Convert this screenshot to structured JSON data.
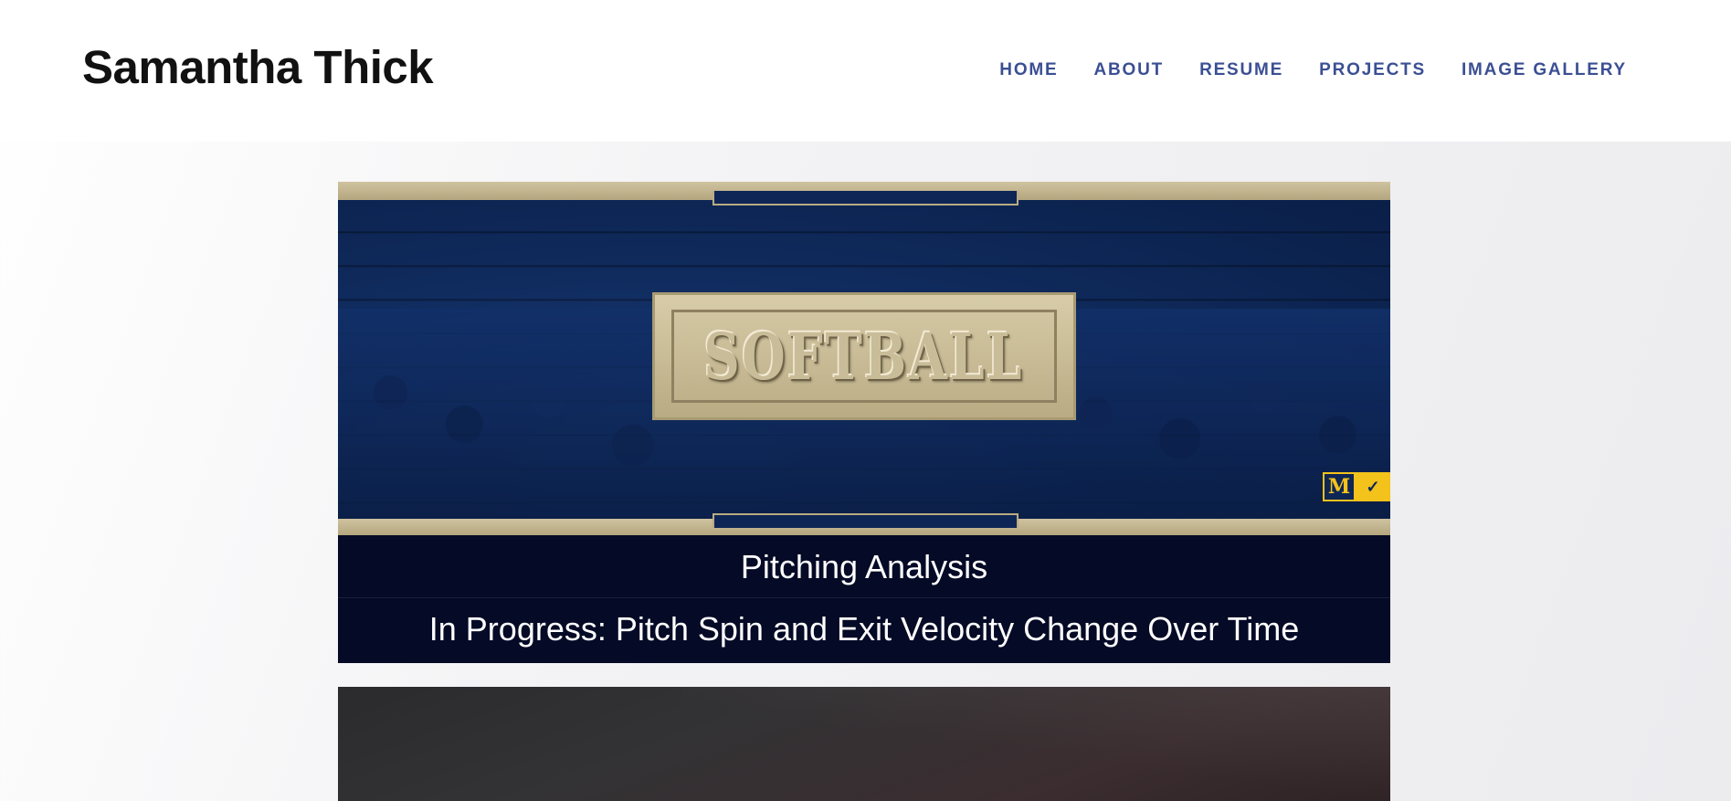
{
  "header": {
    "title": "Samantha Thick",
    "nav": [
      {
        "label": "HOME"
      },
      {
        "label": "ABOUT"
      },
      {
        "label": "RESUME"
      },
      {
        "label": "PROJECTS"
      },
      {
        "label": "IMAGE GALLERY"
      }
    ]
  },
  "projects": [
    {
      "banner_text": "SOFTBALL",
      "logo_letter": "M",
      "title": "Pitching Analysis",
      "subtitle": "In Progress: Pitch Spin and Exit Velocity Change Over Time"
    }
  ],
  "colors": {
    "nav_link": "#3b4f93",
    "caption_bg": "#050a26",
    "banner_blue": "#0f2a5c",
    "banner_gold": "#c9bc97",
    "maize": "#f3c21b"
  },
  "icons": {
    "logo": "michigan-block-m-logo",
    "swoosh": "nike-swoosh-logo"
  }
}
